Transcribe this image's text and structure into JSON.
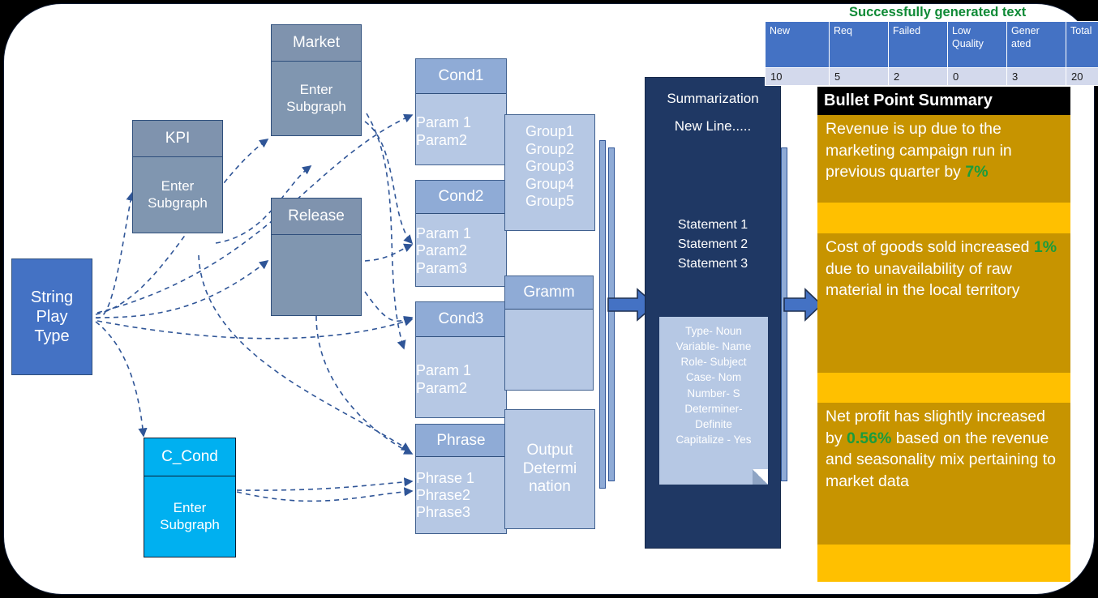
{
  "flow": {
    "start": {
      "label": "String\nPlay\nType"
    },
    "nodes": [
      {
        "title": "Market",
        "body": "Enter\nSubgraph"
      },
      {
        "title": "KPI",
        "body": "Enter\nSubgraph"
      },
      {
        "title": "Release",
        "body": ""
      },
      {
        "title": "C_Cond",
        "body": "Enter\nSubgraph"
      }
    ],
    "conditions": [
      {
        "title": "Cond1",
        "params": [
          "Param 1",
          "Param2"
        ]
      },
      {
        "title": "Cond2",
        "params": [
          "Param 1",
          "Param2",
          "Param3"
        ]
      },
      {
        "title": "Cond3",
        "params": [
          "Param 1",
          "Param2"
        ]
      },
      {
        "title": "Phrase",
        "params": [
          "Phrase 1",
          "Phrase2",
          "Phrase3"
        ]
      }
    ],
    "groups": {
      "items": [
        "Group1",
        "Group2",
        "Group3",
        "Group4",
        "Group5"
      ]
    },
    "gramm": {
      "title": "Gramm",
      "body": ""
    },
    "output": {
      "label": "Output\nDetermi\nnation"
    }
  },
  "summarization": {
    "title": "Summarization",
    "new_line": "New Line.....",
    "statements": [
      "Statement 1",
      "Statement 2",
      "Statement 3"
    ],
    "note": [
      "Type- Noun",
      "Variable- Name",
      "Role- Subject",
      "Case- Nom",
      "Number- S",
      "Determiner-",
      "Definite",
      "Capitalize - Yes"
    ]
  },
  "stats": {
    "caption": "Successfully generated text",
    "headers": [
      "New",
      "Req",
      "Failed",
      "Low Quality",
      "Gener ated",
      "Total"
    ],
    "values": [
      "10",
      "5",
      "2",
      "0",
      "3",
      "20"
    ]
  },
  "bullets": {
    "title": "Bullet Point Summary",
    "items": [
      {
        "pre": "Revenue is up due to the marketing campaign run in previous quarter by ",
        "value": "7%",
        "post": ""
      },
      {
        "pre": "Cost of goods sold increased ",
        "value": "1%",
        "post": " due to unavailability of raw material in the local territory"
      },
      {
        "pre": "Net profit has slightly increased by ",
        "value": "0.56%",
        "post": " based on the revenue and seasonality mix pertaining to market data"
      }
    ]
  },
  "colors": {
    "accent_blue": "#4472c4",
    "slate": "#8096b0",
    "cond_head": "#8fabd6",
    "cond_body": "#b6c8e4",
    "cyan": "#00b0f0",
    "dark_panel": "#1f3864",
    "gold": "#c79400",
    "gold_light": "#ffc000",
    "green": "#1a9c3c"
  }
}
